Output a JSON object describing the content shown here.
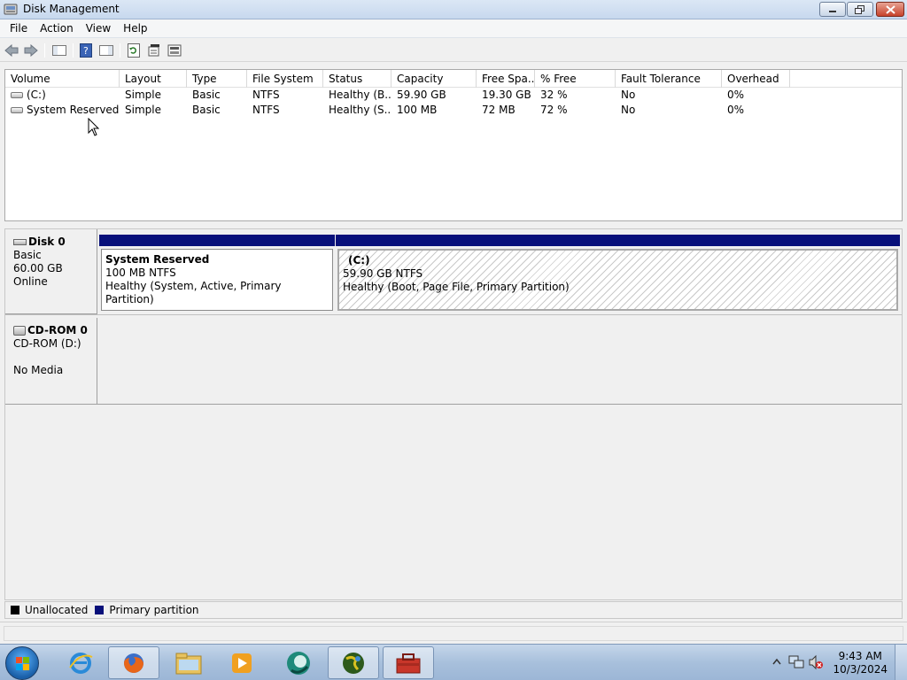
{
  "window": {
    "title": "Disk Management",
    "icon": "disk-management-icon",
    "controls": [
      "minimize-icon",
      "restore-icon",
      "close-icon"
    ]
  },
  "menubar": {
    "items": [
      "File",
      "Action",
      "View",
      "Help"
    ]
  },
  "toolbar": {
    "icons": [
      "back-arrow-icon",
      "forward-arrow-icon",
      "console-tree-icon",
      "help-icon",
      "action-pane-icon",
      "refresh-icon",
      "properties-icon",
      "rescan-disks-icon"
    ]
  },
  "volume_list": {
    "columns": [
      "Volume",
      "Layout",
      "Type",
      "File System",
      "Status",
      "Capacity",
      "Free Spa...",
      "% Free",
      "Fault Tolerance",
      "Overhead"
    ],
    "rows": [
      {
        "volume": "(C:)",
        "layout": "Simple",
        "type": "Basic",
        "file_system": "NTFS",
        "status": "Healthy (B...",
        "capacity": "59.90 GB",
        "free_space": "19.30 GB",
        "percent_free": "32 %",
        "fault_tolerance": "No",
        "overhead": "0%"
      },
      {
        "volume": "System Reserved",
        "layout": "Simple",
        "type": "Basic",
        "file_system": "NTFS",
        "status": "Healthy (S...",
        "capacity": "100 MB",
        "free_space": "72 MB",
        "percent_free": "72 %",
        "fault_tolerance": "No",
        "overhead": "0%"
      }
    ]
  },
  "disks": [
    {
      "name": "Disk 0",
      "kind": "Basic",
      "size": "60.00 GB",
      "state": "Online",
      "partitions": [
        {
          "title": "System Reserved",
          "size_fs": "100 MB NTFS",
          "status": "Healthy (System, Active, Primary Partition)"
        },
        {
          "title": "(C:)",
          "size_fs": "59.90 GB NTFS",
          "status": "Healthy (Boot, Page File, Primary Partition)"
        }
      ]
    },
    {
      "name": "CD-ROM 0",
      "kind": "CD-ROM (D:)",
      "size": "",
      "state": "No Media"
    }
  ],
  "legend": {
    "items": [
      {
        "label": "Unallocated",
        "color": "#000000"
      },
      {
        "label": "Primary partition",
        "color": "#08107a"
      }
    ]
  },
  "taskbar": {
    "start_icon": "windows-start-icon",
    "apps": [
      "internet-explorer-icon",
      "firefox-icon",
      "file-explorer-icon",
      "media-player-icon",
      "browser-icon",
      "globe-app-icon",
      "disk-management-toolbox-icon"
    ],
    "tray_icons": [
      "show-hidden-icons-icon",
      "network-icon",
      "volume-muted-icon"
    ],
    "time": "9:43 AM",
    "date": "10/3/2024"
  },
  "colors": {
    "primary_partition": "#08107a",
    "title_bar": "#c7d8ee",
    "taskbar": "#a8c0dc"
  }
}
